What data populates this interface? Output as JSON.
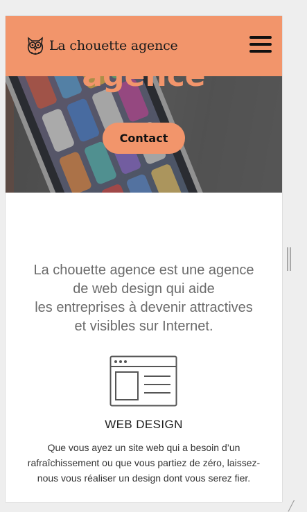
{
  "header": {
    "logo_text": "La chouette agence",
    "menu_icon": "hamburger-menu-icon"
  },
  "hero": {
    "title": "agence",
    "contact_label": "Contact"
  },
  "intro": {
    "lines": [
      "La chouette agence est une agence",
      "de web design qui aide",
      "les entreprises à devenir attractives",
      "et visibles sur Internet."
    ]
  },
  "service": {
    "icon": "web-design-icon",
    "title": "WEB DESIGN",
    "description_lines": [
      "Que vous ayez un site web qui a besoin d’un",
      "rafraîchissement ou que vous partiez de zéro, laissez-",
      "nous vous réaliser un design dont vous serez fier."
    ]
  },
  "colors": {
    "accent": "#f2956b",
    "text_muted": "#6b6b6b",
    "text_dark": "#1e1e1e"
  }
}
